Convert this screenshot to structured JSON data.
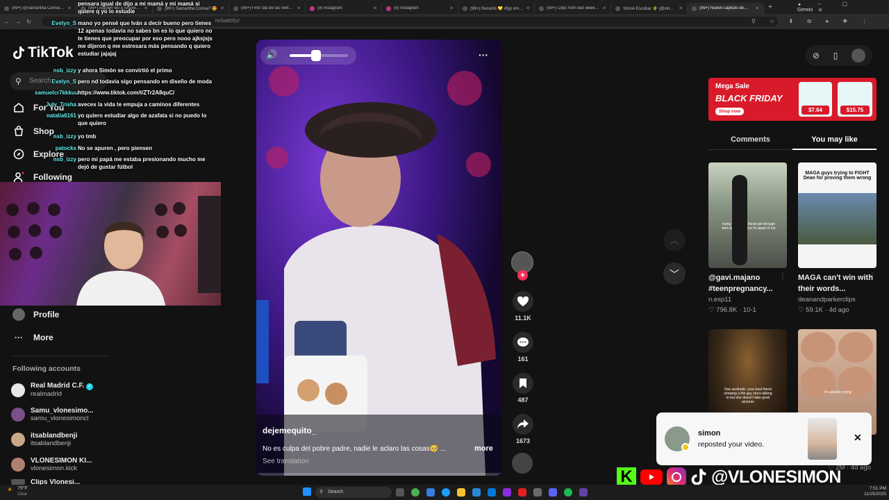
{
  "browser": {
    "tabs": [
      {
        "label": "(99+) @Samantha Correa q..."
      },
      {
        "label": "(99+) Alguien vio a Shaverrr..."
      },
      {
        "label": "(99+) Samantha Correa? 😍"
      },
      {
        "label": "(99+) Find 'dia de las velita'..."
      },
      {
        "label": "(9) Instagram"
      },
      {
        "label": "(9) Instagram"
      },
      {
        "label": "(99+) Recents 💛 #fyp #micr..."
      },
      {
        "label": "(99+) Clips from last weekend..."
      },
      {
        "label": "Simon Escobar 🌵 (@vlonesi..."
      },
      {
        "label": "(99+) Nuevo capitulo de..."
      }
    ],
    "gemini_label": "Gemini",
    "url_fragment": "hoSa8Gfy2",
    "url_user": "Evelyn_S"
  },
  "sidebar": {
    "logo": "TikTok",
    "search_placeholder": "Search",
    "nav": [
      {
        "label": "For You",
        "icon": "home-icon"
      },
      {
        "label": "Shop",
        "icon": "shop-icon"
      },
      {
        "label": "Explore",
        "icon": "compass-icon"
      },
      {
        "label": "Following",
        "icon": "following-icon"
      },
      {
        "label": "Profile",
        "icon": "profile-icon"
      },
      {
        "label": "More",
        "icon": "more-icon"
      }
    ],
    "following_header": "Following accounts",
    "accounts": [
      {
        "name": "Real Madrid C.F.",
        "handle": "realmadrid",
        "verified": true
      },
      {
        "name": "Samu_vlonesimo...",
        "handle": "samu_vlonesimoncl"
      },
      {
        "name": "itsablandbenji",
        "handle": "itsablandbenji"
      },
      {
        "name": "VLONESIMON KI...",
        "handle": "vlonesimon.kick"
      },
      {
        "name": "Clips Vlonesi...",
        "handle": ""
      }
    ]
  },
  "chat": [
    {
      "user": "",
      "msg": "pensara igual de dijo a mi mamá y mi mamá si quiere q yo lo estudie"
    },
    {
      "user": "Evelyn_S",
      "msg": "mano yo pensé que Iván a decir bueno pero tienes 12 apenas todavía no sabes bn es lo que quiero no te tienes que preocupar por eso pero nooo ajksjsjs me dijeron q me estresara más pensando q quiero estudiar jajajaj"
    },
    {
      "user": "nsb_izzy",
      "msg": "y ahora Simón se convirtió el primo"
    },
    {
      "user": "Evelyn_S",
      "msg": "pero nd todavía sigo pensando en diseño de moda"
    },
    {
      "user": "samuelcr7kkkuu",
      "msg": "https://www.tiktok.com/t/ZTr2A8quC/"
    },
    {
      "user": "July_Trisha",
      "msg": "aveces la vida te empuja a caminos diferentes"
    },
    {
      "user": "natalia6161",
      "msg": "yo quiero estudiar algo de azafata si no puedo lo que quiero"
    },
    {
      "user": "nsb_izzy",
      "msg": "yo tmb"
    },
    {
      "user": "patocks",
      "msg": "No se apuren , pero piensen"
    },
    {
      "user": "nsb_izzy",
      "msg": "pero mi papá me estaba presionando mucho me dejó de gustar fútbol"
    }
  ],
  "video": {
    "author": "dejemequito_",
    "caption": "No es culpa del pobre padre, nadie le aclaro las cosas🥺 ...",
    "more_label": "more",
    "see_translation": "See translation",
    "volume_level": 0.45
  },
  "actions": {
    "likes": "11.1K",
    "comments": "161",
    "saves": "487",
    "shares": "1673"
  },
  "right_panel": {
    "ad": {
      "line1": "Mega Sale",
      "line2": "BLACK FRIDAY",
      "cta": "Shop now",
      "price1": "$7.64",
      "price2": "$15.75"
    },
    "tabs": [
      "Comments",
      "You may like"
    ],
    "active_tab": 1,
    "cards": [
      {
        "title": "@gavi.majano #teenpregnancy...",
        "author": "n.esp11",
        "likes": "796.8K",
        "date": "10-1",
        "thumb_text": "trying to see my friend get through teen pregnancy but i'm apart of me"
      },
      {
        "title": "MAGA can't win with their words...",
        "author": "deanandparkerclips",
        "likes": "59.1K",
        "date": "4d ago",
        "thumb_text": "MAGA guys trying to FIGHT Dean for proving them wrong"
      },
      {
        "title": "",
        "author": "",
        "likes": "",
        "date": "",
        "thumb_text": "Rae aesthetic: your best friend showing a the guy she's talking to but she doesn't take good pictures"
      },
      {
        "title": "",
        "author": "",
        "likes": "2M",
        "date": "4d ago",
        "thumb_text": "i'm actually crying"
      }
    ]
  },
  "notification": {
    "user": "simon",
    "text": "reposted your video."
  },
  "stream_overlay": {
    "handle": "@VLONESIMON"
  },
  "taskbar": {
    "weather_temp": "79°F",
    "weather_desc": "Clear",
    "search_placeholder": "Search",
    "time": "7:51 PM",
    "date": "11/25/2025"
  },
  "colors": {
    "accent": "#fe2c55",
    "bg": "#121212",
    "ad_bg": "#d81a2a"
  }
}
